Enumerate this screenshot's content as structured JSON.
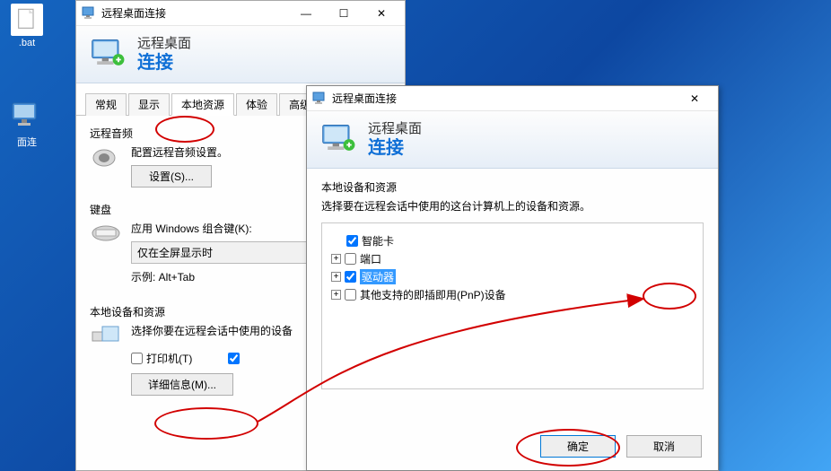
{
  "desktop": {
    "icon1_label": ".bat",
    "icon2_label": "面连"
  },
  "dialog1": {
    "title": "远程桌面连接",
    "app_line1": "远程桌面",
    "app_line2": "连接",
    "tabs": [
      {
        "label": "常规"
      },
      {
        "label": "显示"
      },
      {
        "label": "本地资源"
      },
      {
        "label": "体验"
      },
      {
        "label": "高级"
      }
    ],
    "audio": {
      "title": "远程音频",
      "desc": "配置远程音频设置。",
      "button": "设置(S)..."
    },
    "keyboard": {
      "title": "键盘",
      "desc": "应用 Windows 组合键(K):",
      "value": "仅在全屏显示时",
      "example": "示例: Alt+Tab"
    },
    "local": {
      "title": "本地设备和资源",
      "desc": "选择你要在远程会话中使用的设备",
      "printer_label": "打印机(T)",
      "details_button": "详细信息(M)..."
    }
  },
  "dialog2": {
    "title": "远程桌面连接",
    "app_line1": "远程桌面",
    "app_line2": "连接",
    "section_title": "本地设备和资源",
    "section_desc": "选择要在远程会话中使用的这台计算机上的设备和资源。",
    "items": [
      {
        "label": "智能卡",
        "checked": true,
        "expand": ""
      },
      {
        "label": "端口",
        "checked": false,
        "expand": "+"
      },
      {
        "label": "驱动器",
        "checked": true,
        "expand": "+",
        "highlighted": true
      },
      {
        "label": "其他支持的即插即用(PnP)设备",
        "checked": false,
        "expand": "+"
      }
    ],
    "ok": "确定",
    "cancel": "取消"
  }
}
